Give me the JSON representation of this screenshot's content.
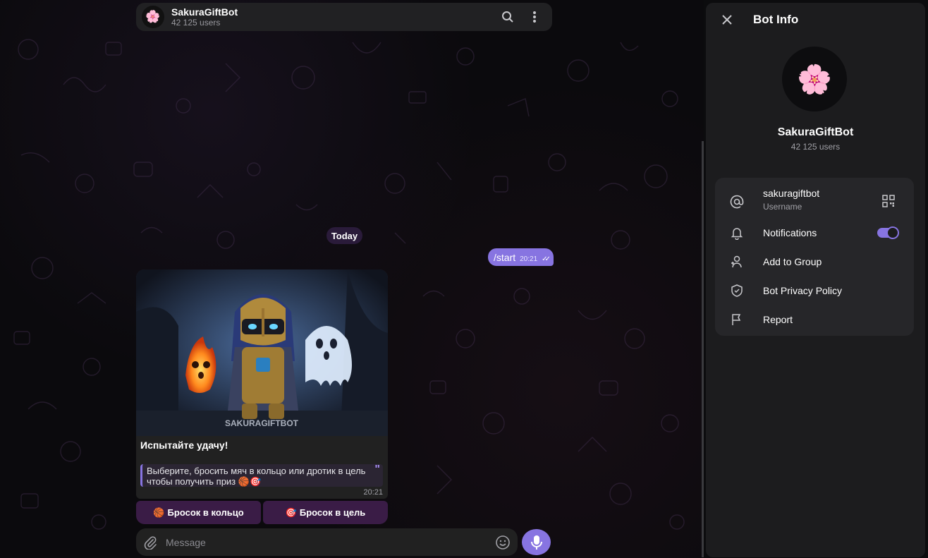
{
  "chat_header": {
    "avatar_emoji": "🌸",
    "title": "SakuraGiftBot",
    "subtitle": "42 125 users",
    "search_icon": "search-icon",
    "more_icon": "more-vertical-icon"
  },
  "date_chip": "Today",
  "outgoing": {
    "text": "/start",
    "time": "20:21",
    "status_icon": "double-check-icon"
  },
  "bot_message": {
    "image_watermark": "SAKURAGIFTBOT",
    "heading": "Испытайте удачу!",
    "quote_text": "Выберите, бросить мяч в кольцо или дротик в цель чтобы получить приз 🏀🎯",
    "time": "20:21"
  },
  "keyboard": [
    {
      "emoji": "🏀",
      "label": "Бросок в кольцо"
    },
    {
      "emoji": "🎯",
      "label": "Бросок в цель"
    }
  ],
  "composer": {
    "placeholder": "Message",
    "attach_icon": "paperclip-icon",
    "emoji_icon": "smile-icon",
    "mic_icon": "microphone-icon"
  },
  "panel": {
    "title": "Bot Info",
    "avatar_emoji": "🌸",
    "name": "SakuraGiftBot",
    "users": "42 125 users",
    "rows": [
      {
        "label": "sakuragiftbot",
        "sublabel": "Username",
        "icon": "at-icon"
      },
      {
        "label": "Notifications",
        "icon": "bell-icon",
        "toggle_on": true
      },
      {
        "label": "Add to Group",
        "icon": "add-user-icon"
      },
      {
        "label": "Bot Privacy Policy",
        "icon": "shield-check-icon"
      },
      {
        "label": "Report",
        "icon": "flag-icon"
      }
    ]
  },
  "colors": {
    "accent": "#8774e1",
    "panel": "#1c1c1e",
    "bubble": "#212121",
    "keyboard_button": "#3a1c46"
  }
}
